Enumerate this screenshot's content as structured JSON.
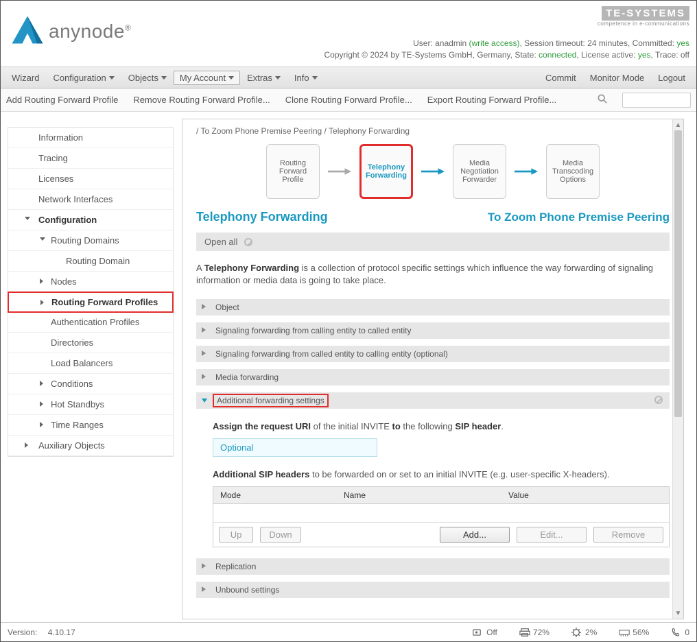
{
  "header": {
    "brand_name": "anynode",
    "brand_reg": "®",
    "company_name": "TE-SYSTEMS",
    "company_tag": "competence in e-communications",
    "status_line1": {
      "user_label": "User:",
      "user": "anadmin",
      "access": "(write access)",
      "timeout_label": ", Session timeout:",
      "timeout": "24 minutes",
      "committed_label": ", Committed:",
      "committed": "yes"
    },
    "status_line2": {
      "copyright": "Copyright © 2024 by TE-Systems GmbH, Germany, State:",
      "state": "connected",
      "license_label": ", License active:",
      "license": "yes",
      "trace_label": ", Trace:",
      "trace": "off"
    }
  },
  "menubar": {
    "wizard": "Wizard",
    "configuration": "Configuration",
    "objects": "Objects",
    "my_account": "My Account",
    "extras": "Extras",
    "info": "Info",
    "commit": "Commit",
    "monitor": "Monitor Mode",
    "logout": "Logout"
  },
  "toolbar": {
    "add": "Add Routing Forward Profile",
    "remove": "Remove Routing Forward Profile...",
    "clone": "Clone Routing Forward Profile...",
    "export": "Export Routing Forward Profile..."
  },
  "sidebar": {
    "information": "Information",
    "tracing": "Tracing",
    "licenses": "Licenses",
    "network": "Network Interfaces",
    "configuration": "Configuration",
    "routing_domains": "Routing Domains",
    "routing_domain": "Routing Domain",
    "nodes": "Nodes",
    "rfp": "Routing Forward Profiles",
    "auth": "Authentication Profiles",
    "directories": "Directories",
    "load_balancers": "Load Balancers",
    "conditions": "Conditions",
    "hot_standbys": "Hot Standbys",
    "time_ranges": "Time Ranges",
    "aux": "Auxiliary Objects"
  },
  "main": {
    "breadcrumb_a": "To Zoom Phone Premise Peering",
    "breadcrumb_b": "Telephony Forwarding",
    "flow": {
      "rfp": "Routing Forward Profile",
      "tf": "Telephony Forwarding",
      "mnf": "Media Negotiation Forwarder",
      "mto": "Media Transcoding Options"
    },
    "title_left": "Telephony Forwarding",
    "title_right": "To Zoom Phone Premise Peering",
    "open_all": "Open all",
    "desc_a": "A ",
    "desc_b": "Telephony Forwarding",
    "desc_c": " is a collection of protocol specific settings which influence the way forwarding of signaling information or media data is going to take place.",
    "sections": {
      "object": "Object",
      "s1": "Signaling forwarding from calling entity to called entity",
      "s2": "Signaling forwarding from called entity to calling entity (optional)",
      "media": "Media forwarding",
      "additional": "Additional forwarding settings",
      "replication": "Replication",
      "unbound": "Unbound settings"
    },
    "additional_body": {
      "l1a": "Assign the request URI",
      "l1b": " of the initial INVITE ",
      "l1c": "to",
      "l1d": " the following ",
      "l1e": "SIP header",
      "l1f": ".",
      "input": "Optional",
      "l2a": "Additional SIP headers",
      "l2b": " to be forwarded on or set to an initial INVITE (e.g. user-specific X-headers).",
      "cols": {
        "mode": "Mode",
        "name": "Name",
        "value": "Value"
      },
      "btns": {
        "up": "Up",
        "down": "Down",
        "add": "Add...",
        "edit": "Edit...",
        "remove": "Remove"
      }
    }
  },
  "statusbar": {
    "version_label": "Version:",
    "version": "4.10.17",
    "record": "Off",
    "session": "72%",
    "cpu": "2%",
    "mem": "56%",
    "calls": "0"
  }
}
